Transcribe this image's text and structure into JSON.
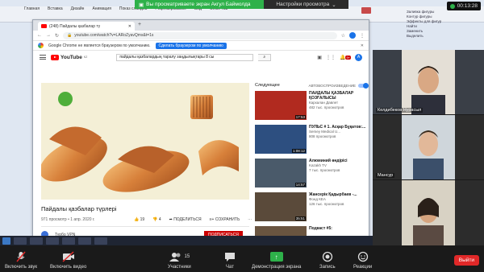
{
  "zoom": {
    "banner_text": "Вы просматриваете экран Акгул Баймолда",
    "view_options": "Настройки просмотра",
    "timer": "00:13:28",
    "participant_count": "15",
    "toolbar": {
      "unmute": "Включить звук",
      "video": "Включить видео",
      "participants": "Участники",
      "chat": "Чат",
      "share": "Демонстрация экрана",
      "record": "Запись",
      "reactions": "Реакции",
      "leave": "Выйти"
    },
    "tiles": [
      {
        "name": "Келдибеков Нурасыл"
      },
      {
        "name": "Мансур"
      },
      {
        "name": ""
      }
    ]
  },
  "ppt": {
    "tabs": [
      "Главная",
      "Вставка",
      "Дизайн",
      "Анимация",
      "Показ слайдов",
      "Рецензирование",
      "Вид",
      "Office Tab"
    ],
    "right_items": [
      "Заливка фигуры",
      "Контур фигуры",
      "Эффекты для фигур",
      "Найти",
      "Заменить",
      "Выделить"
    ]
  },
  "browser": {
    "tab_title": "(248) Пайдалы қазбалар тү",
    "url": "youtube.com/watch?v=LARoZyavQms&t=1s",
    "infobar_text": "Google Chrome не является браузером по умолчанию.",
    "infobar_button": "Сделать браузером по умолчанию"
  },
  "youtube": {
    "logo": "YouTube",
    "logo_region": "KZ",
    "search_value": "пайдалы қазбалардың таралу заңдылықтары 8 сы",
    "notifications": "9+",
    "avatar_letter": "А",
    "video_title": "Пайдалы қазбалар түрлері",
    "video_meta": "971 просмотр • 1 апр. 2020 г.",
    "likes": "19",
    "dislikes": "4",
    "share_label": "ПОДЕЛИТЬСЯ",
    "save_label": "СОХРАНИТЬ",
    "subscribe": "ПОДПИСАТЬСЯ",
    "upnext_label": "Следующее",
    "autoplay_label": "АВТОВОСПРОИЗВЕДЕНИЕ",
    "channel_label": "Турбо VPN",
    "recommendations": [
      {
        "title": "ПАЙДАЛЫ ҚАЗБАЛАР ҚОЗҒАЛЫСЫ",
        "channel": "Кархалан Давлет",
        "views": "482 тыс. просмотров",
        "duration": "17:53",
        "color": "#b12a1f"
      },
      {
        "title": "ПУЛЬС # 1. Асқар Бұқатов:...",
        "channel": "Semey Medical U...",
        "views": "808 просмотров",
        "duration": "1:08:12",
        "color": "#2d4f80"
      },
      {
        "title": "Алюминий өндірісі",
        "channel": "Kazakh TV",
        "views": "7 тыс. просмотров",
        "duration": "14:57",
        "color": "#4a5a6a"
      },
      {
        "title": "Жансерік Қадырбаев -...",
        "channel": "Фонд КЕА",
        "views": "126 тыс. просмотров",
        "duration": "35:51",
        "color": "#5a4a3a"
      },
      {
        "title": "Подкаст #5:",
        "channel": "",
        "views": "",
        "duration": "",
        "color": "#6a5540"
      }
    ]
  }
}
